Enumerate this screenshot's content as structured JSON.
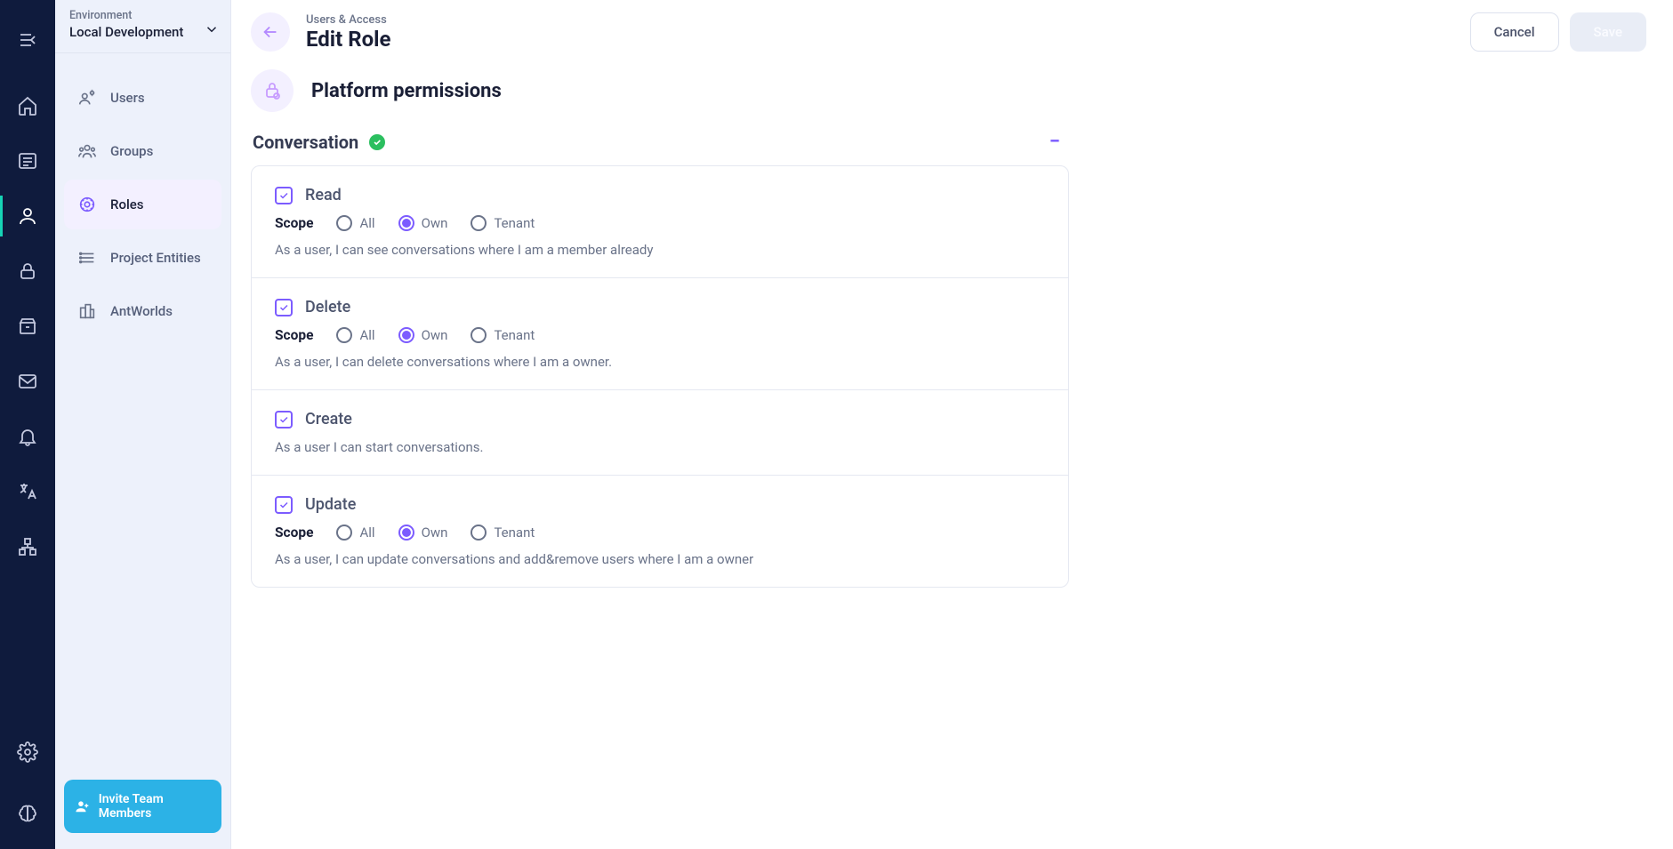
{
  "rail": {
    "items": [
      "menu",
      "home",
      "content",
      "users",
      "security",
      "archive",
      "mail",
      "notifications",
      "language",
      "nodes"
    ],
    "active_index": 3
  },
  "sidebar": {
    "env_label": "Environment",
    "env_value": "Local Development",
    "items": [
      {
        "label": "Users"
      },
      {
        "label": "Groups"
      },
      {
        "label": "Roles"
      },
      {
        "label": "Project Entities"
      },
      {
        "label": "AntWorlds"
      }
    ],
    "active_index": 2,
    "invite_label": "Invite Team Members"
  },
  "header": {
    "breadcrumb": "Users & Access",
    "page_title": "Edit Role",
    "cancel_label": "Cancel",
    "save_label": "Save"
  },
  "section_title": "Platform permissions",
  "group": {
    "title": "Conversation",
    "scope_label": "Scope",
    "scope_options": [
      "All",
      "Own",
      "Tenant"
    ],
    "perms": [
      {
        "name": "Read",
        "checked": true,
        "has_scope": true,
        "selected_scope": 1,
        "description": "As a user, I can see conversations where I am a member already"
      },
      {
        "name": "Delete",
        "checked": true,
        "has_scope": true,
        "selected_scope": 1,
        "description": "As a user, I can delete conversations where I am a owner."
      },
      {
        "name": "Create",
        "checked": true,
        "has_scope": false,
        "description": "As a user I can start conversations."
      },
      {
        "name": "Update",
        "checked": true,
        "has_scope": true,
        "selected_scope": 1,
        "description": "As a user, I can update conversations and add&remove users where I am a owner"
      }
    ]
  }
}
